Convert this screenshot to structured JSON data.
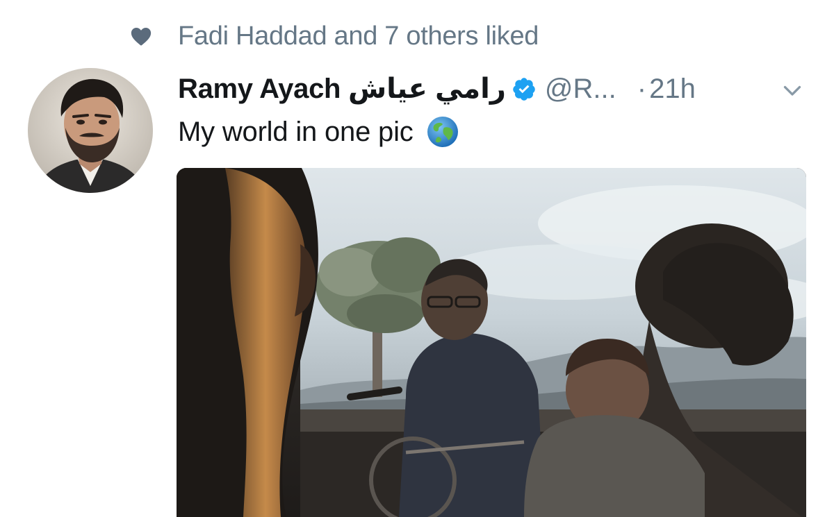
{
  "social_context": {
    "icon": "heart-icon",
    "text": "Fadi Haddad and 7 others liked"
  },
  "tweet": {
    "avatar": "avatar-photo",
    "display_name": "Ramy Ayach رامي عياش",
    "verified": true,
    "handle": "@R...",
    "separator": "·",
    "timestamp": "21h",
    "caret_icon": "chevron-down-icon",
    "text": "My world in one pic",
    "emoji_icon": "globe-icon",
    "media": {
      "type": "photo"
    }
  },
  "colors": {
    "primary_text": "#14171a",
    "secondary_text": "#657786",
    "verified_blue": "#1da1f2",
    "background": "#ffffff"
  }
}
